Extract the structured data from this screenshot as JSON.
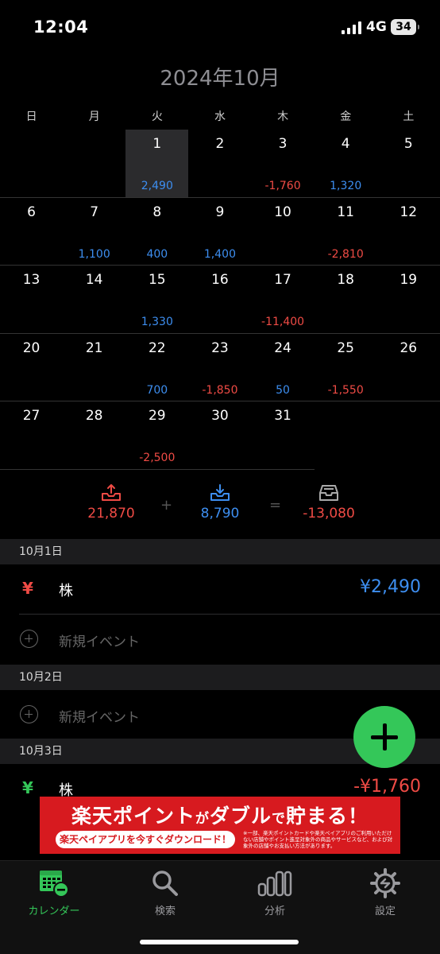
{
  "status": {
    "time": "12:04",
    "network": "4G",
    "battery": "34"
  },
  "title": "2024年10月",
  "weekdays": [
    "日",
    "月",
    "火",
    "水",
    "木",
    "金",
    "土"
  ],
  "weeks": [
    [
      {
        "d": ""
      },
      {
        "d": ""
      },
      {
        "d": "1",
        "a": "2,490",
        "c": "blue",
        "sel": true
      },
      {
        "d": "2"
      },
      {
        "d": "3",
        "a": "-1,760",
        "c": "red"
      },
      {
        "d": "4",
        "a": "1,320",
        "c": "blue"
      },
      {
        "d": "5"
      }
    ],
    [
      {
        "d": "6"
      },
      {
        "d": "7",
        "a": "1,100",
        "c": "blue"
      },
      {
        "d": "8",
        "a": "400",
        "c": "blue"
      },
      {
        "d": "9",
        "a": "1,400",
        "c": "blue"
      },
      {
        "d": "10"
      },
      {
        "d": "11",
        "a": "-2,810",
        "c": "red"
      },
      {
        "d": "12"
      }
    ],
    [
      {
        "d": "13"
      },
      {
        "d": "14"
      },
      {
        "d": "15",
        "a": "1,330",
        "c": "blue"
      },
      {
        "d": "16"
      },
      {
        "d": "17",
        "a": "-11,400",
        "c": "red"
      },
      {
        "d": "18"
      },
      {
        "d": "19"
      }
    ],
    [
      {
        "d": "20"
      },
      {
        "d": "21"
      },
      {
        "d": "22",
        "a": "700",
        "c": "blue"
      },
      {
        "d": "23",
        "a": "-1,850",
        "c": "red"
      },
      {
        "d": "24",
        "a": "50",
        "c": "blue"
      },
      {
        "d": "25",
        "a": "-1,550",
        "c": "red"
      },
      {
        "d": "26"
      }
    ],
    [
      {
        "d": "27"
      },
      {
        "d": "28"
      },
      {
        "d": "29",
        "a": "-2,500",
        "c": "red"
      },
      {
        "d": "30"
      },
      {
        "d": "31"
      }
    ]
  ],
  "summary": {
    "expense": "21,870",
    "plus": "+",
    "income": "8,790",
    "equals": "=",
    "balance": "-13,080"
  },
  "sections": {
    "oct1": {
      "header": "10月1日",
      "yen": "¥",
      "label": "株",
      "amount": "¥2,490"
    },
    "new1": "新規イベント",
    "oct2": {
      "header": "10月2日"
    },
    "new2": "新規イベント",
    "oct3": {
      "header": "10月3日",
      "yen": "¥",
      "label": "株",
      "amount": "-¥1,760"
    }
  },
  "ad": {
    "headline_a": "楽天ポイント",
    "headline_b": "が",
    "headline_c": "ダブル",
    "headline_d": "で",
    "headline_e": "貯まる！",
    "button": "楽天ペイアプリを今すぐダウンロード！",
    "note": "※一部、楽天ポイントカードや楽天ペイアプリのご利用いただけない店舗やポイント進呈対象外の商品やサービスなど、および対象外の店舗やお支払い方法があります。"
  },
  "tabs": {
    "calendar": "カレンダー",
    "search": "検索",
    "analysis": "分析",
    "settings": "設定"
  },
  "colors": {
    "income": "#3d8ef0",
    "expense": "#ef4b45",
    "accent": "#34c759"
  }
}
